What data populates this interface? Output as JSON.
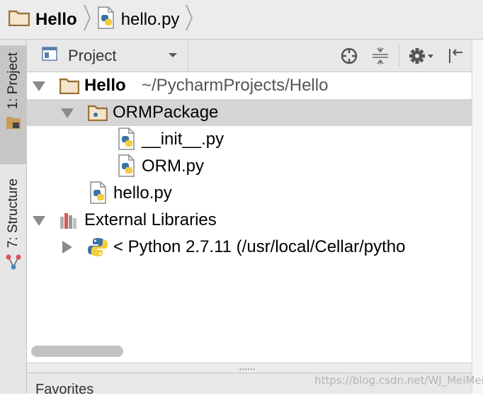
{
  "breadcrumb": {
    "items": [
      {
        "label": "Hello",
        "icon": "folder-icon"
      },
      {
        "label": "hello.py",
        "icon": "python-file-icon"
      }
    ]
  },
  "tool_strip": {
    "tabs": [
      {
        "label": "1: Project",
        "icon": "project-folder-icon",
        "active": true
      },
      {
        "label": "7: Structure",
        "icon": "structure-icon",
        "active": false
      }
    ]
  },
  "panel_header": {
    "view_label": "Project",
    "tools": [
      "locate-target-icon",
      "collapse-all-icon",
      "settings-gear-icon",
      "hide-panel-icon"
    ]
  },
  "tree": {
    "rows": [
      {
        "label": "Hello",
        "path": "~/PycharmProjects/Hello",
        "icon": "folder-icon",
        "expanded": true,
        "bold": true
      },
      {
        "label": "ORMPackage",
        "icon": "package-folder-icon",
        "expanded": true,
        "selected": true
      },
      {
        "label": "__init__.py",
        "icon": "python-file-icon"
      },
      {
        "label": "ORM.py",
        "icon": "python-file-icon"
      },
      {
        "label": "hello.py",
        "icon": "python-file-icon"
      },
      {
        "label": "External Libraries",
        "icon": "libraries-icon",
        "expanded": true
      },
      {
        "label": "< Python 2.7.11 (/usr/local/Cellar/pytho",
        "icon": "python-logo-icon",
        "expanded": false
      }
    ]
  },
  "favorites": {
    "label": "Favorites"
  },
  "watermark": "https://blog.csdn.net/WJ_MeiMei",
  "colors": {
    "folder": "#c89b57",
    "python_blue": "#3b73a6",
    "python_yellow": "#f5cc3c",
    "selected_row": "#d5d5d5"
  }
}
